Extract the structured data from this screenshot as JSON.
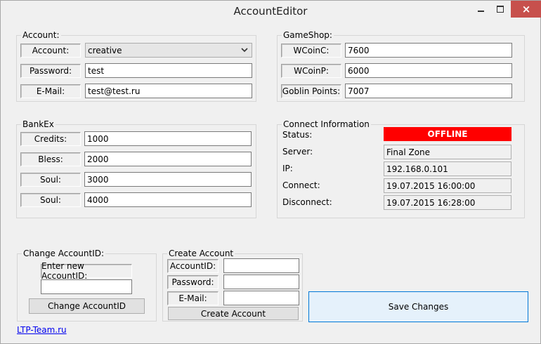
{
  "window": {
    "title": "AccountEditor",
    "close_glyph": "×"
  },
  "account": {
    "legend": "Account:",
    "account_label": "Account:",
    "account_value": "creative",
    "password_label": "Password:",
    "password_value": "test",
    "email_label": "E-Mail:",
    "email_value": "test@test.ru"
  },
  "gameshop": {
    "legend": "GameShop:",
    "wcoinc_label": "WCoinC:",
    "wcoinc_value": "7600",
    "wcoinp_label": "WCoinP:",
    "wcoinp_value": "6000",
    "goblin_label": "Goblin Points:",
    "goblin_value": "7007"
  },
  "bankex": {
    "legend": "BankEx",
    "credits_label": "Credits:",
    "credits_value": "1000",
    "bless_label": "Bless:",
    "bless_value": "2000",
    "soul_label": "Soul:",
    "soul_value": "3000",
    "soul2_label": "Soul:",
    "soul2_value": "4000"
  },
  "connect": {
    "legend": "Connect Information",
    "status_label": "Status:",
    "status_value": "OFFLINE",
    "server_label": "Server:",
    "server_value": "Final Zone",
    "ip_label": "IP:",
    "ip_value": "192.168.0.101",
    "connect_label": "Connect:",
    "connect_value": "19.07.2015 16:00:00",
    "disconnect_label": "Disconnect:",
    "disconnect_value": "19.07.2015 16:28:00",
    "status_color": "#ff0000"
  },
  "change_account": {
    "legend": "Change AccountID:",
    "enter_label": "Enter new AccountID:",
    "input_value": "",
    "button_label": "Change AccountID"
  },
  "create_account": {
    "legend": "Create Account",
    "accountid_label": "AccountID:",
    "accountid_value": "",
    "password_label": "Password:",
    "password_value": "",
    "email_label": "E-Mail:",
    "email_value": "",
    "button_label": "Create Account"
  },
  "save_button_label": "Save Changes",
  "footer_link": "LTP-Team.ru",
  "icons": {
    "minimize": "minimize-icon",
    "maximize": "maximize-icon",
    "close": "close-icon",
    "dropdown": "chevron-down-icon"
  }
}
